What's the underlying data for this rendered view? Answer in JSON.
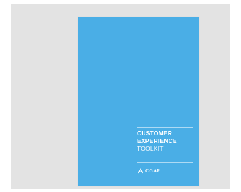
{
  "cover": {
    "title_line1": "CUSTOMER",
    "title_line2": "EXPERIENCE",
    "title_line3": "TOOLKIT",
    "brand_text": "CGAP"
  },
  "colors": {
    "cover_blue": "#4aaee6",
    "frame_gray": "#e3e3e3",
    "text": "#ffffff"
  }
}
